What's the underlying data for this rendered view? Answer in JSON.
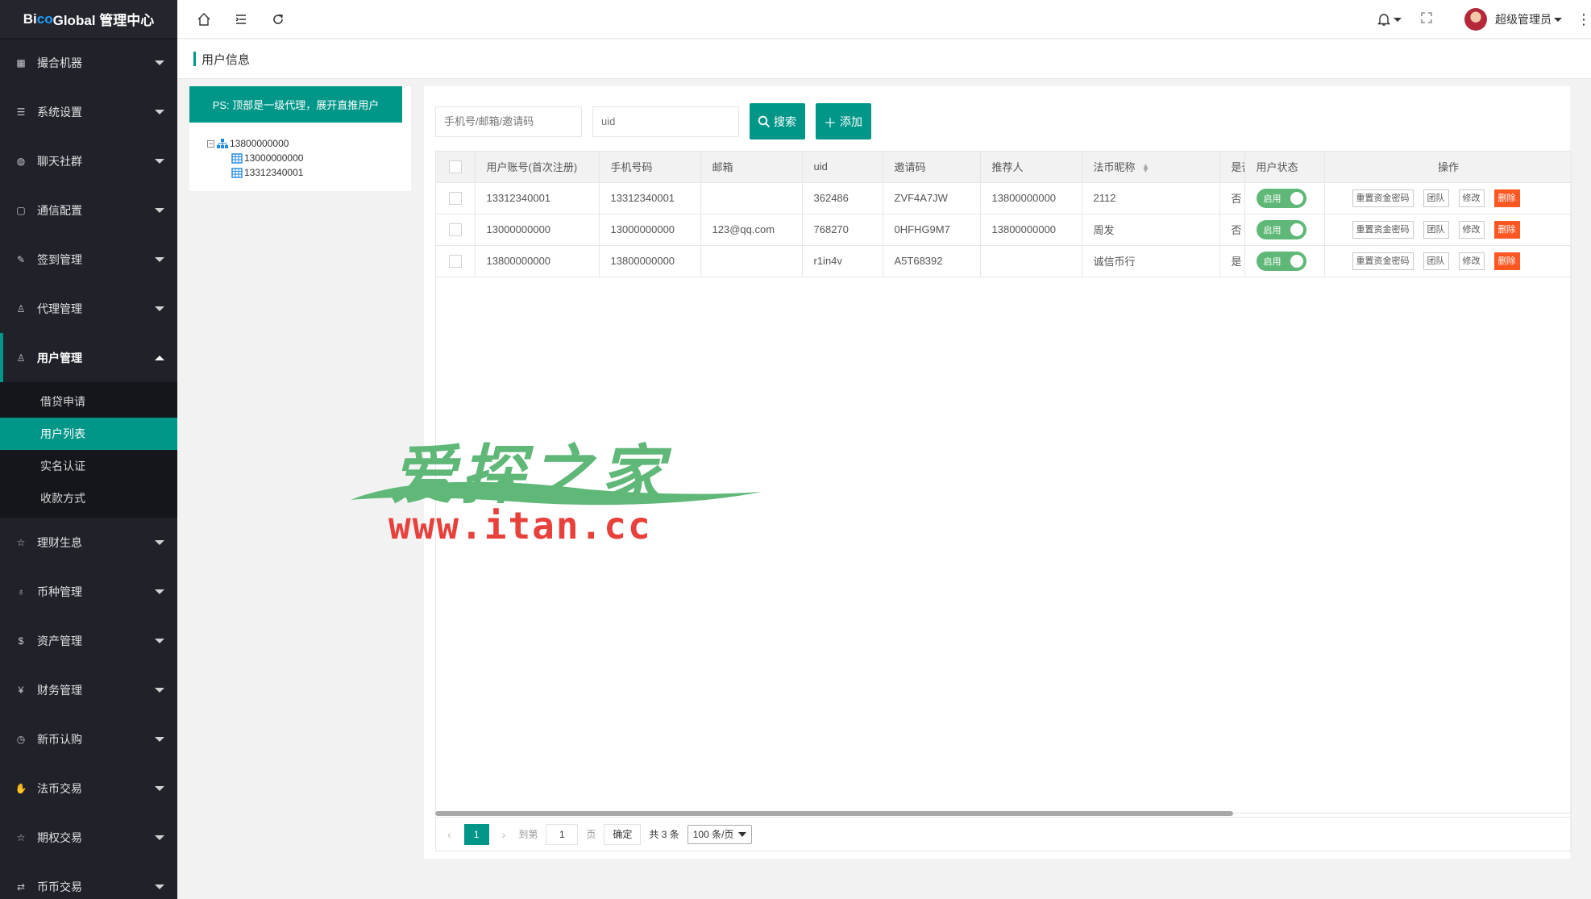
{
  "app": {
    "title_part1": "Bi",
    "title_part2": "co",
    "title_part3": " Global 管理中心"
  },
  "sidebar": {
    "items": [
      {
        "label": "撮合机器",
        "icon": "grid-icon"
      },
      {
        "label": "系统设置",
        "icon": "sliders-icon"
      },
      {
        "label": "聊天社群",
        "icon": "chat-icon"
      },
      {
        "label": "通信配置",
        "icon": "device-icon"
      },
      {
        "label": "签到管理",
        "icon": "edit-icon"
      },
      {
        "label": "代理管理",
        "icon": "person-icon"
      },
      {
        "label": "用户管理",
        "icon": "users-icon"
      },
      {
        "label": "理财生息",
        "icon": "star-icon"
      },
      {
        "label": "币种管理",
        "icon": "coins-icon"
      },
      {
        "label": "资产管理",
        "icon": "dollar-icon"
      },
      {
        "label": "财务管理",
        "icon": "yen-icon"
      },
      {
        "label": "新币认购",
        "icon": "clock-icon"
      },
      {
        "label": "法币交易",
        "icon": "hand-icon"
      },
      {
        "label": "期权交易",
        "icon": "star-icon"
      },
      {
        "label": "币币交易",
        "icon": "exchange-icon"
      }
    ],
    "submenu": [
      "借贷申请",
      "用户列表",
      "实名认证",
      "收款方式"
    ]
  },
  "header": {
    "user_name": "超级管理员"
  },
  "breadcrumb": {
    "title": "用户信息"
  },
  "tree": {
    "ps_button": "PS: 顶部是一级代理，展开直推用户",
    "root": "13800000000",
    "children": [
      "13000000000",
      "13312340001"
    ]
  },
  "search": {
    "phone_placeholder": "手机号/邮箱/邀请码",
    "uid_placeholder": "uid",
    "search_label": "搜索",
    "add_label": "添加"
  },
  "table": {
    "headers": [
      "用户账号(首次注册)",
      "手机号码",
      "邮箱",
      "uid",
      "邀请码",
      "推荐人",
      "法币昵称",
      "是否",
      "用户状态",
      "操作"
    ],
    "rows": [
      {
        "account": "13312340001",
        "phone": "13312340001",
        "email": "",
        "uid": "362486",
        "invite": "ZVF4A7JW",
        "referrer": "13800000000",
        "nickname": "2112",
        "flag": "否",
        "status": "启用"
      },
      {
        "account": "13000000000",
        "phone": "13000000000",
        "email": "123@qq.com",
        "uid": "768270",
        "invite": "0HFHG9M7",
        "referrer": "13800000000",
        "nickname": "周发",
        "flag": "否",
        "status": "启用"
      },
      {
        "account": "13800000000",
        "phone": "13800000000",
        "email": "",
        "uid": "r1in4v",
        "invite": "A5T68392",
        "referrer": "",
        "nickname": "诚信币行",
        "flag": "是",
        "status": "启用"
      }
    ],
    "ops": [
      "重置资金密码",
      "团队",
      "修改",
      "删除"
    ]
  },
  "pager": {
    "current": "1",
    "goto_label": "到第",
    "goto_value": "1",
    "page_unit": "页",
    "confirm": "确定",
    "total": "共 3 条",
    "per_page": "100 条/页"
  },
  "watermark": {
    "cn": "爱探之家",
    "url": "www.itan.cc"
  },
  "colors": {
    "accent": "#009688",
    "sidebar_bg": "#20222a",
    "switch_on": "#5fb878",
    "danger": "#ff5722"
  }
}
